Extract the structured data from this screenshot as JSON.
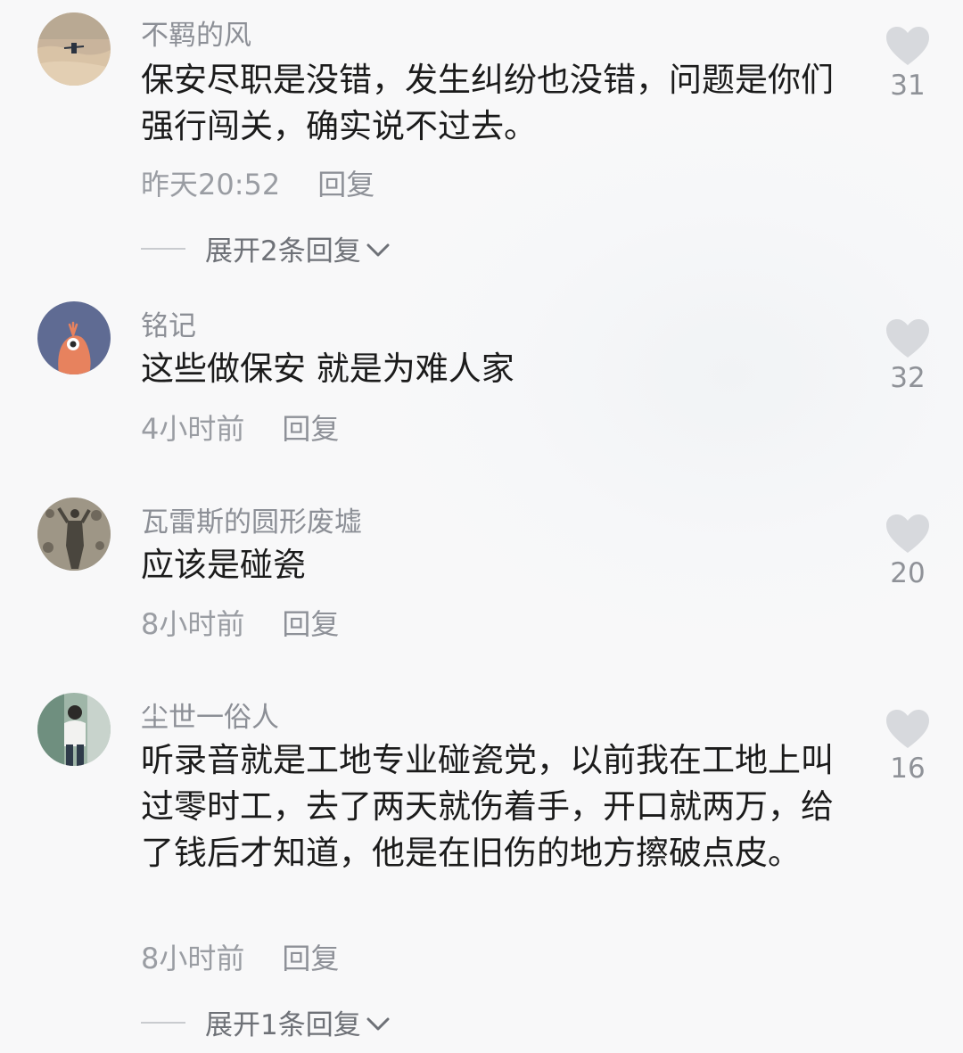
{
  "comments": [
    {
      "username": "不羁的风",
      "text": "保安尽职是没错，发生纠纷也没错，问题是你们强行闯关，确实说不过去。",
      "time": "昨天20:52",
      "reply": "回复",
      "likes": "31",
      "expand": "展开2条回复"
    },
    {
      "username": "铭记",
      "text": "这些做保安 就是为难人家",
      "time": "4小时前",
      "reply": "回复",
      "likes": "32"
    },
    {
      "username": "瓦雷斯的圆形废墟",
      "text": "应该是碰瓷",
      "time": "8小时前",
      "reply": "回复",
      "likes": "20"
    },
    {
      "username": "尘世一俗人",
      "text": "听录音就是工地专业碰瓷党，以前我在工地上叫过零时工，去了两天就伤着手，开口就两万，给了钱后才知道，他是在旧伤的地方擦破点皮。",
      "time": "8小时前",
      "reply": "回复",
      "likes": "16",
      "expand": "展开1条回复"
    }
  ],
  "icons": {
    "like": "heart-icon",
    "expand": "chevron-down-icon"
  },
  "colors": {
    "background": "#f7f8f9",
    "username": "#8c8f96",
    "text": "#1b1b1b",
    "meta": "#9a9da3",
    "heart": "#d7d9dd"
  }
}
